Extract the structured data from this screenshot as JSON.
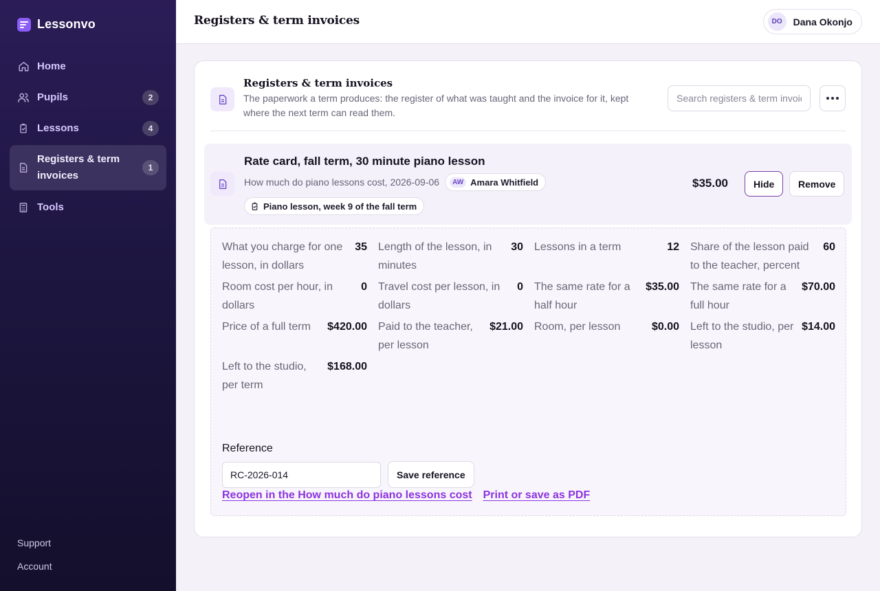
{
  "app": {
    "name": "Lessonvo"
  },
  "colors": {
    "accent": "#8b5cf6",
    "link": "#8d33e0",
    "sidebar_bg": "#1d1640"
  },
  "sidebar": {
    "items": [
      {
        "label": "Home",
        "icon": "home-icon",
        "badge": ""
      },
      {
        "label": "Pupils",
        "icon": "users-icon",
        "badge": "2"
      },
      {
        "label": "Lessons",
        "icon": "lesson-clipboard-icon",
        "badge": "4"
      },
      {
        "label": "Registers & term invoices",
        "icon": "document-icon",
        "badge": "1"
      },
      {
        "label": "Tools",
        "icon": "calculator-icon",
        "badge": ""
      }
    ],
    "bottom": {
      "support": "Support",
      "account": "Account"
    }
  },
  "header": {
    "title": "Registers & term invoices",
    "user": {
      "initials": "DO",
      "name": "Dana Okonjo"
    }
  },
  "panel": {
    "title": "Registers & term invoices",
    "description": "The paperwork a term produces: the register of what was taught and the invoice for it, kept where the next term can read them.",
    "search_placeholder": "Search registers & term invoices"
  },
  "entry": {
    "title": "Rate card, fall term, 30 minute piano lesson",
    "source": "How much do piano lessons cost, 2026-09-06",
    "pupil_initials": "AW",
    "pupil_name": "Amara Whitfield",
    "lesson_tag": "Piano lesson, week 9 of the fall term",
    "price": "$35.00",
    "hide_label": "Hide",
    "remove_label": "Remove"
  },
  "details": {
    "stats": [
      {
        "label": "What you charge for one lesson, in dollars",
        "value": "35"
      },
      {
        "label": "Length of the lesson, in minutes",
        "value": "30"
      },
      {
        "label": "Lessons in a term",
        "value": "12"
      },
      {
        "label": "Share of the lesson paid to the teacher, percent",
        "value": "60"
      },
      {
        "label": "Room cost per hour, in dollars",
        "value": "0"
      },
      {
        "label": "Travel cost per lesson, in dollars",
        "value": "0"
      },
      {
        "label": "The same rate for a half hour",
        "value": "$35.00"
      },
      {
        "label": "The same rate for a full hour",
        "value": "$70.00"
      },
      {
        "label": "Price of a full term",
        "value": "$420.00"
      },
      {
        "label": "Paid to the teacher, per lesson",
        "value": "$21.00"
      },
      {
        "label": "Room, per lesson",
        "value": "$0.00"
      },
      {
        "label": "Left to the studio, per lesson",
        "value": "$14.00"
      },
      {
        "label": "Left to the studio, per term",
        "value": "$168.00"
      }
    ],
    "reference_label": "Reference",
    "reference_value": "RC-2026-014",
    "save_reference_label": "Save reference",
    "reopen_link": "Reopen in the How much do piano lessons cost",
    "print_link": "Print or save as PDF"
  }
}
